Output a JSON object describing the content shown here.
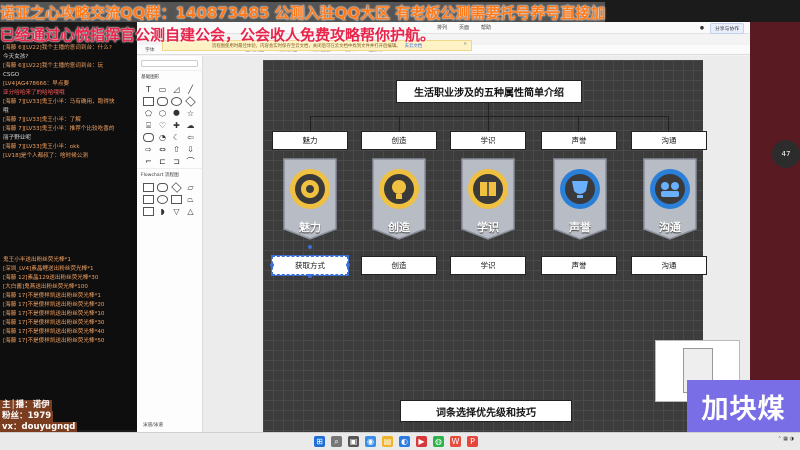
{
  "banners": {
    "line1": "诺亚之心攻略交流QQ群：140873485   公测入驻QQ大区   有老板公测需要托号养号直接加",
    "line2": "已经通过心悦指挥官公测自建公会，公会收人免费攻略帮你护航。"
  },
  "chat": {
    "messages": [
      {
        "text": "[海藤 6][LV22]我个主播的意词到台：什么?",
        "style": "sys"
      },
      {
        "text": "今天女孩?",
        "style": ""
      },
      {
        "text": "[海藤 6][LV22]我个主播的意词到台：玩",
        "style": "sys"
      },
      {
        "text": "CSGO",
        "style": ""
      },
      {
        "text": "[LV4]AG478666：早点要",
        "style": "sys"
      },
      {
        "text": "亚分哈哈来了的哈哈哦哦",
        "style": "red"
      },
      {
        "text": "[海藤 7][LV33]鬼王小半：马有确用，跑得快",
        "style": "sys"
      },
      {
        "text": "哦",
        "style": ""
      },
      {
        "text": "[海藤 7][LV33]鬼王小半：了解",
        "style": "sys"
      },
      {
        "text": "[海藤 7][LV33]鬼王小半：推荐个比较吃香的",
        "style": "sys"
      },
      {
        "text": "丽子野业呢",
        "style": ""
      },
      {
        "text": "[海藤 7][LV33]鬼王小半：okk",
        "style": "sys"
      },
      {
        "text": "[LV18]是个人都叔了：啥时候公测",
        "style": "sys"
      }
    ],
    "gifts": [
      "鬼王小半送出粉丝荧光棒*1",
      "[深圳_LV4]素晶鲤送出粉丝荧光棒*1",
      "[海藤 12]素晶129送出粉丝荧光棒*30",
      "[大白酱]鬼燕送出粉丝荧光棒*100",
      "[海藤 17]不是傻样凯送出粉丝荧光棒*1",
      "[海藤 17]不是傻样凯送出粉丝荧光棒*20",
      "[海藤 17]不是傻样凯送出粉丝荧光棒*10",
      "[海藤 17]不是傻样凯送出粉丝荧光棒*30",
      "[海藤 17]不是傻样凯送出粉丝荧光棒*40",
      "[海藤 17]不是傻样凯送出粉丝荧光棒*50"
    ]
  },
  "editor": {
    "menu": [
      "排列",
      "页面",
      "帮助"
    ],
    "toolbar": [
      "字体",
      "10px",
      "B",
      "I",
      "U",
      "连线类型",
      "线条颜色",
      "线条宽度",
      "箭头",
      "连接线"
    ],
    "share_label": "分享与协作",
    "sidebar": {
      "section_basic": "基础图形",
      "section_flowchart": "Flowchart 流程图",
      "section_bottom": "泳道/泳道"
    },
    "notice": {
      "text": "流程图使用时最佳体验，内容会实时保存至云文档，关闭后可在云文档中找到文件并打开后编辑。",
      "link": "去云文档"
    }
  },
  "diagram": {
    "title": "生活职业涉及的五种属性简单介绍",
    "footer_title": "词条选择优先级和技巧",
    "attributes": [
      "魅力",
      "创造",
      "学识",
      "声誉",
      "沟通"
    ],
    "sub_labels": [
      "获取方式",
      "创造",
      "学识",
      "声誉",
      "沟通"
    ],
    "badge_labels": [
      "魅力",
      "创造",
      "学识",
      "声誉",
      "沟通"
    ],
    "colors": {
      "badge_ring": "#e3a520",
      "badge_ring_blue": "#2a7fd8",
      "selected": "#3b6fd8"
    }
  },
  "overlay": {
    "streamer_lines": [
      "主│播：诺伊",
      "粉丝：1979",
      "vx：douyugnqd"
    ],
    "right_word": "加块煤",
    "zoom_text": "47"
  }
}
